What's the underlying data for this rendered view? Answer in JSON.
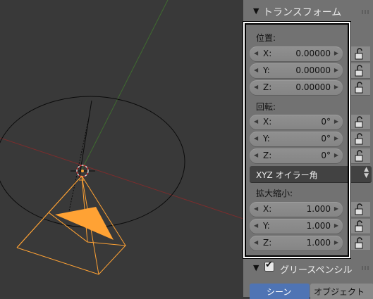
{
  "panel": {
    "title": "トランスフォーム",
    "location": {
      "label": "位置:",
      "fields": [
        {
          "axis": "X:",
          "value": "0.00000"
        },
        {
          "axis": "Y:",
          "value": "0.00000"
        },
        {
          "axis": "Z:",
          "value": "0.00000"
        }
      ]
    },
    "rotation": {
      "label": "回転:",
      "fields": [
        {
          "axis": "X:",
          "value": "0°"
        },
        {
          "axis": "Y:",
          "value": "0°"
        },
        {
          "axis": "Z:",
          "value": "0°"
        }
      ],
      "mode": "XYZ オイラー角"
    },
    "scale": {
      "label": "拡大縮小:",
      "fields": [
        {
          "axis": "X:",
          "value": "1.000"
        },
        {
          "axis": "Y:",
          "value": "1.000"
        },
        {
          "axis": "Z:",
          "value": "1.000"
        }
      ]
    }
  },
  "grease_pencil": {
    "title": "グリースペンシル",
    "checked": true,
    "tabs": [
      "シーン",
      "オブジェクト"
    ]
  },
  "colors": {
    "accent_blue": "#4f74b4",
    "selected_orange": "#ffa234",
    "panel_bg": "#727272",
    "viewport_bg": "#393939"
  },
  "icons": {
    "lock": "padlock-open-icon",
    "collapse": "triangle-down-icon",
    "menu_chevron": "up-down-chevron-icon"
  }
}
